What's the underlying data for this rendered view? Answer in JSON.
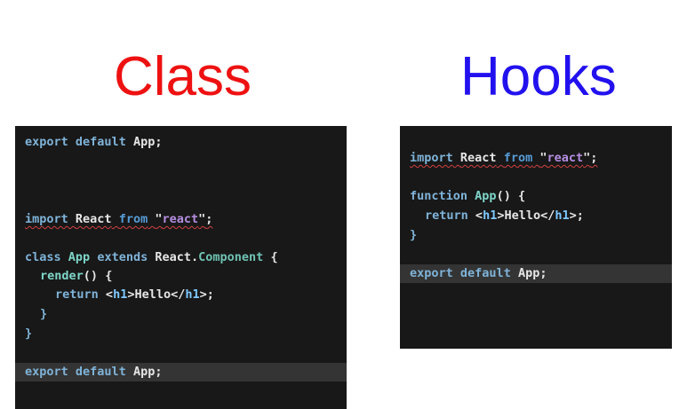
{
  "headings": {
    "class": "Class",
    "hooks": "Hooks",
    "class_color": "#ee1111",
    "hooks_color": "#2211ee"
  },
  "class_editor": {
    "export_top": {
      "kw1": "export",
      "kw2": "default",
      "name": "App",
      "semi": ";"
    },
    "import": {
      "kw": "import",
      "name": "React",
      "from": "from",
      "q1": "\"",
      "str": "react",
      "q2": "\"",
      "semi": ";"
    },
    "class_decl": {
      "kw": "class",
      "name": "App",
      "extends": "extends",
      "base": "React",
      "dot": ".",
      "component": "Component",
      "brace": "{"
    },
    "render": {
      "name": "render",
      "parens": "()",
      "brace": "{"
    },
    "return": {
      "kw": "return",
      "open": "<",
      "tag1": "h1",
      "gt": ">",
      "text": "Hello",
      "close": "</",
      "tag2": "h1",
      "end": ">;"
    },
    "close_inner": "}",
    "close_outer": "}",
    "export_bottom": {
      "kw1": "export",
      "kw2": "default",
      "name": "App",
      "semi": ";"
    }
  },
  "hooks_editor": {
    "import": {
      "kw": "import",
      "name": "React",
      "from": "from",
      "q1": "\"",
      "str": "react",
      "q2": "\"",
      "semi": ";"
    },
    "func_decl": {
      "kw": "function",
      "name": "App",
      "parens": "()",
      "brace": "{"
    },
    "return": {
      "kw": "return",
      "open": "<",
      "tag1": "h1",
      "gt": ">",
      "text": "Hello",
      "close": "</",
      "tag2": "h1",
      "end": ">;"
    },
    "close": "}",
    "export_bottom": {
      "kw1": "export",
      "kw2": "default",
      "name": "App",
      "semi": ";"
    }
  }
}
